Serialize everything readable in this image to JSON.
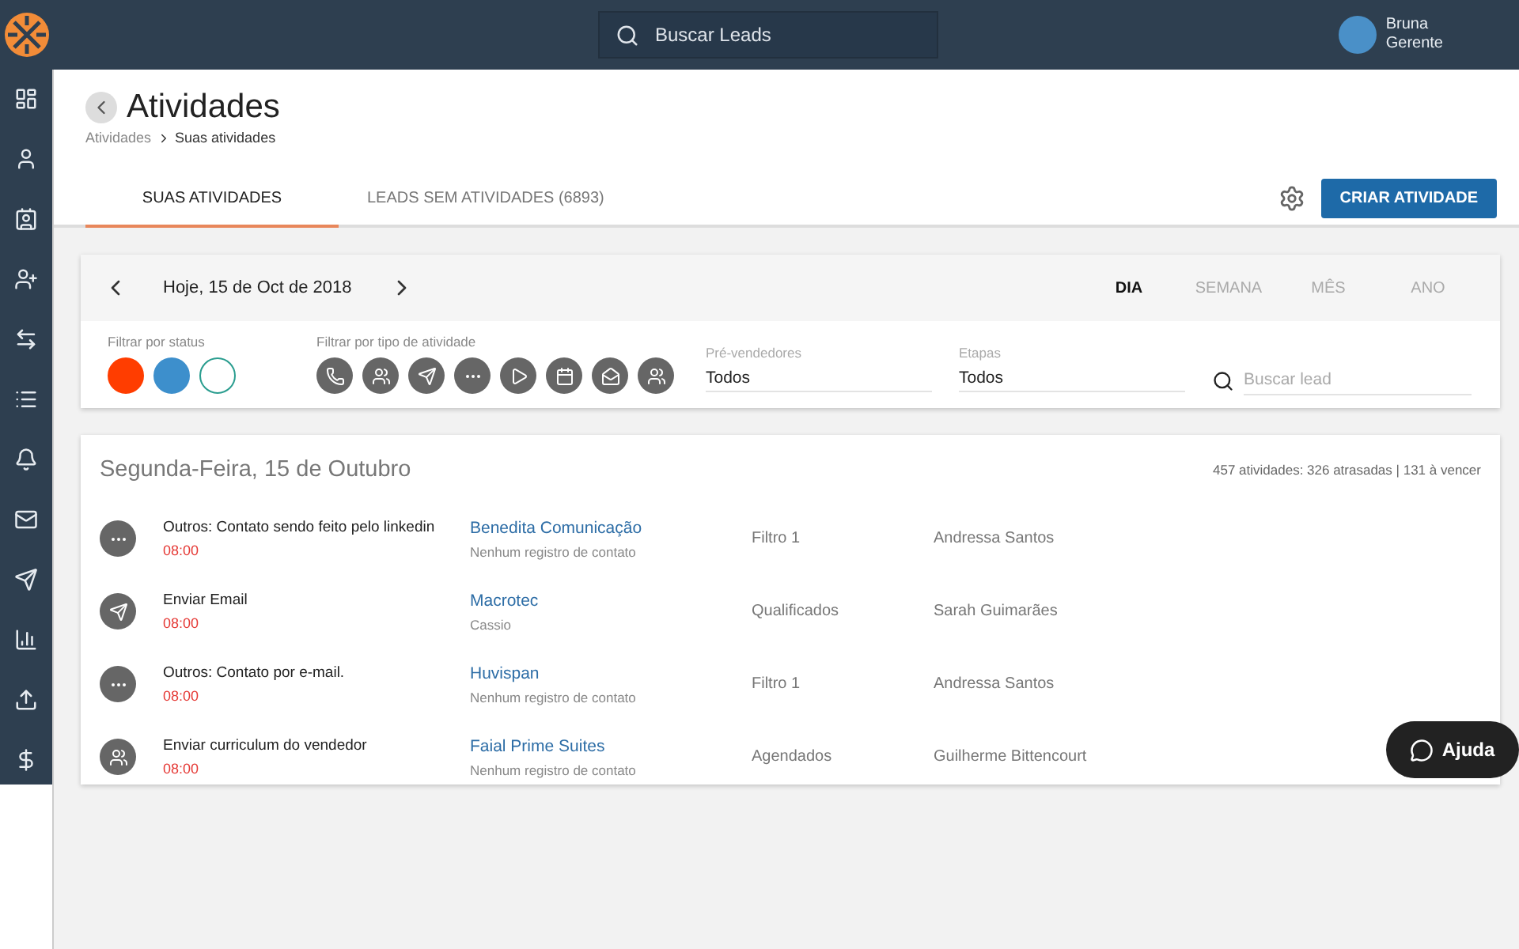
{
  "topbar": {
    "search_placeholder": "Buscar Leads",
    "user": {
      "name": "Bruna",
      "role": "Gerente"
    }
  },
  "sidebar": {
    "items": [
      {
        "kind": "dashboard"
      },
      {
        "kind": "user"
      },
      {
        "kind": "contact"
      },
      {
        "kind": "userplus"
      },
      {
        "kind": "swap"
      },
      {
        "kind": "list"
      },
      {
        "kind": "bell"
      },
      {
        "kind": "mail"
      },
      {
        "kind": "send"
      },
      {
        "kind": "chart"
      },
      {
        "kind": "upload"
      },
      {
        "kind": "dollar"
      }
    ]
  },
  "header": {
    "title": "Atividades",
    "breadcrumb": [
      "Atividades",
      "Suas atividades"
    ]
  },
  "tabs": [
    {
      "label": "SUAS ATIVIDADES",
      "selected": true
    },
    {
      "label": "LEADS SEM ATIVIDADES (6893)",
      "selected": false
    }
  ],
  "create_button": "CRIAR ATIVIDADE",
  "date_bar": {
    "date": "Hoje, 15 de Oct de 2018",
    "periods": [
      {
        "label": "DIA",
        "selected": true
      },
      {
        "label": "SEMANA",
        "selected": false
      },
      {
        "label": "MÊS",
        "selected": false
      },
      {
        "label": "ANO",
        "selected": false
      }
    ]
  },
  "filters": {
    "status_label": "Filtrar por status",
    "statuses": [
      {
        "color": "#ff3d00",
        "outlined": false
      },
      {
        "color": "#3d8fcc",
        "outlined": false
      },
      {
        "color": "#2a9d8f",
        "outlined": true
      }
    ],
    "type_label": "Filtrar por tipo de atividade",
    "types": [
      {
        "kind": "call"
      },
      {
        "kind": "group"
      },
      {
        "kind": "send"
      },
      {
        "kind": "more"
      },
      {
        "kind": "play"
      },
      {
        "kind": "calendar"
      },
      {
        "kind": "mail"
      },
      {
        "kind": "people"
      }
    ],
    "selects": [
      {
        "label": "Pré-vendedores",
        "value": "Todos"
      },
      {
        "label": "Etapas",
        "value": "Todos"
      }
    ],
    "lead_search_placeholder": "Buscar lead"
  },
  "day": {
    "title": "Segunda-Feira, 15 de Outubro",
    "summary": "457 atividades: 326 atrasadas | 131 à vencer",
    "rows": [
      {
        "kind": "more",
        "activity": "Outros: Contato sendo feito pelo linkedin",
        "time": "08:00",
        "company": "Benedita Comunicação",
        "contact": "Nenhum registro de contato",
        "stage": "Filtro 1",
        "owner": "Andressa Santos"
      },
      {
        "kind": "send",
        "activity": "Enviar Email",
        "time": "08:00",
        "company": "Macrotec",
        "contact": "Cassio",
        "stage": "Qualificados",
        "owner": "Sarah Guimarães"
      },
      {
        "kind": "more",
        "activity": "Outros: Contato por e-mail.",
        "time": "08:00",
        "company": "Huvispan",
        "contact": "Nenhum registro de contato",
        "stage": "Filtro 1",
        "owner": "Andressa Santos"
      },
      {
        "kind": "people",
        "activity": "Enviar curriculum do vendedor",
        "time": "08:00",
        "company": "Faial Prime Suites",
        "contact": "Nenhum registro de contato",
        "stage": "Agendados",
        "owner": "Guilherme Bittencourt"
      }
    ]
  },
  "help_button": "Ajuda"
}
